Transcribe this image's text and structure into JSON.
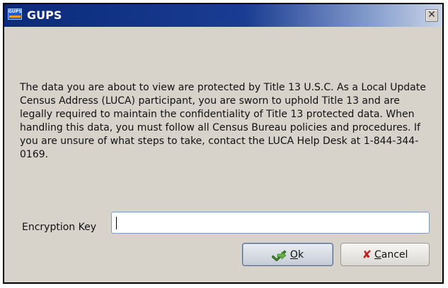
{
  "window": {
    "title": "GUPS",
    "app_icon_text": "GUPS",
    "close_glyph": "✕"
  },
  "message": "The data you are about to view are protected by Title 13 U.S.C.  As a Local Update Census Address (LUCA) participant, you are sworn to uphold Title 13 and are legally required to maintain the confidentiality of Title 13 protected data. When handling this data, you must follow all Census Bureau policies and procedures. If you are unsure of what steps to take, contact the LUCA Help Desk at 1-844-344-0169.",
  "encryption": {
    "label": "Encryption Key",
    "value": ""
  },
  "buttons": {
    "ok_label_first": "O",
    "ok_label_rest": "k",
    "cancel_label_first": "C",
    "cancel_label_rest": "ancel",
    "ok_icon": "green-check-arrow-icon",
    "cancel_icon": "red-x-icon"
  },
  "colors": {
    "titlebar_start": "#0b2a7a",
    "client_bg": "#d7d3cb",
    "cancel_icon": "#c22020",
    "ok_icon": "#3f8a2a"
  }
}
